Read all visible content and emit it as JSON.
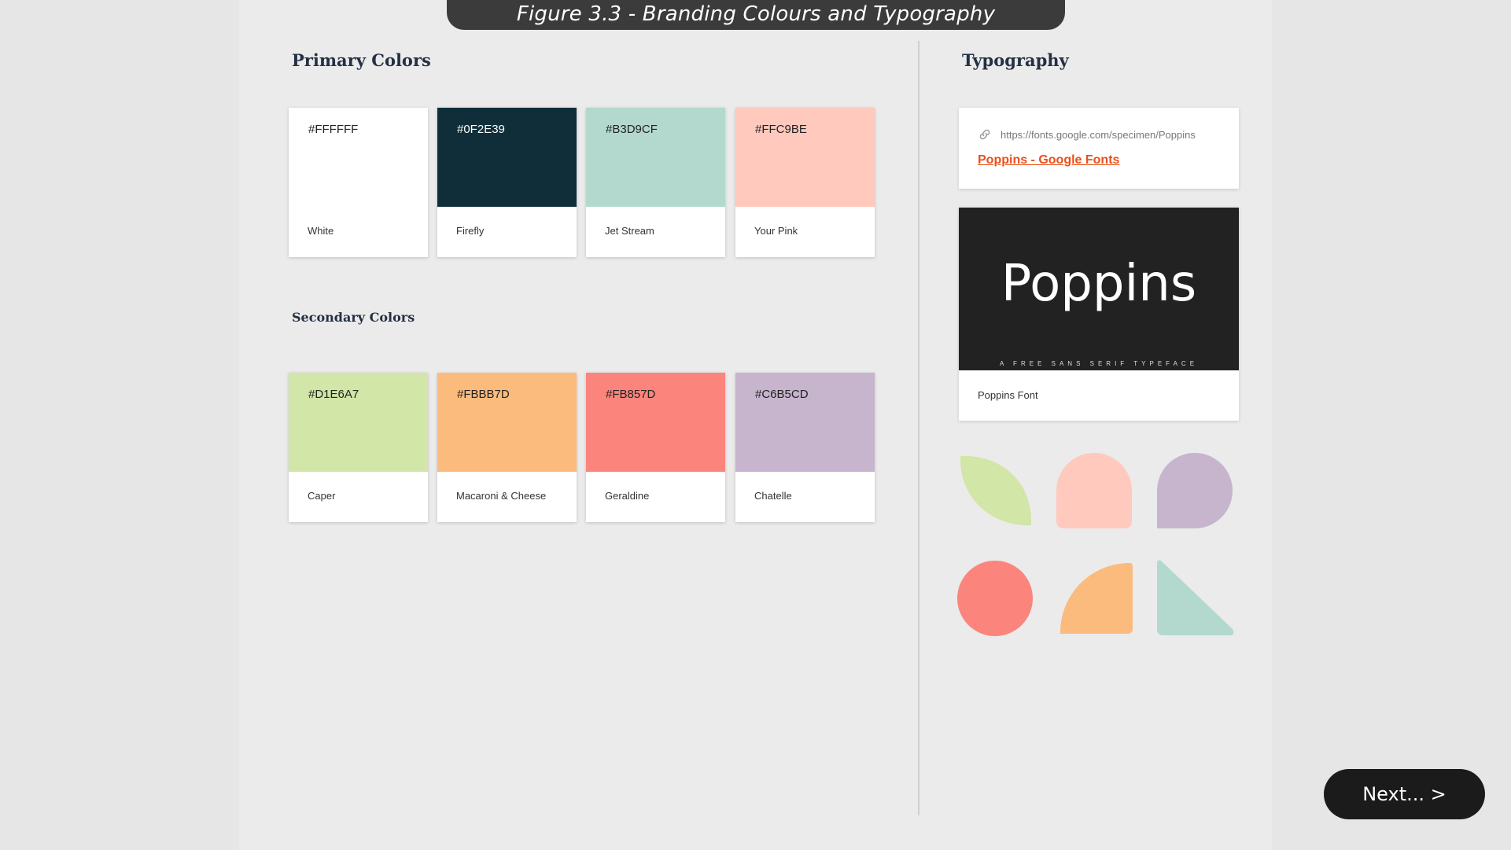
{
  "figure_title": "Figure 3.3 - Branding Colours and Typography",
  "primary": {
    "heading": "Primary Colors",
    "swatches": [
      {
        "hex": "#FFFFFF",
        "name": "White",
        "color": "#FFFFFF"
      },
      {
        "hex": "#0F2E39",
        "name": "Firefly",
        "color": "#0F2E39"
      },
      {
        "hex": "#B3D9CF",
        "name": "Jet Stream",
        "color": "#B3D9CF"
      },
      {
        "hex": "#FFC9BE",
        "name": "Your Pink",
        "color": "#FFC9BE"
      }
    ]
  },
  "secondary": {
    "heading": "Secondary Colors",
    "swatches": [
      {
        "hex": "#D1E6A7",
        "name": "Caper",
        "color": "#D1E6A7"
      },
      {
        "hex": "#FBBB7D",
        "name": "Macaroni & Cheese",
        "color": "#FBBB7D"
      },
      {
        "hex": "#FB857D",
        "name": "Geraldine",
        "color": "#FB857D"
      },
      {
        "hex": "#C6B5CD",
        "name": "Chatelle",
        "color": "#C6B5CD"
      }
    ]
  },
  "typography": {
    "heading": "Typography",
    "link_url": "https://fonts.google.com/specimen/Poppins",
    "link_title": "Poppins - Google Fonts",
    "preview_text": "Poppins",
    "preview_subtitle": "A FREE SANS SERIF TYPEFACE",
    "font_name": "Poppins Font"
  },
  "shapes": [
    {
      "name": "leaf-shape",
      "color": "#D1E6A7"
    },
    {
      "name": "arch-shape",
      "color": "#FFC9BE"
    },
    {
      "name": "drop-shape",
      "color": "#C6B5CD"
    },
    {
      "name": "circle-shape",
      "color": "#FB857D"
    },
    {
      "name": "quarter-shape",
      "color": "#FBBB7D"
    },
    {
      "name": "triangle-shape",
      "color": "#B3D9CF"
    }
  ],
  "next_button": "Next... >"
}
